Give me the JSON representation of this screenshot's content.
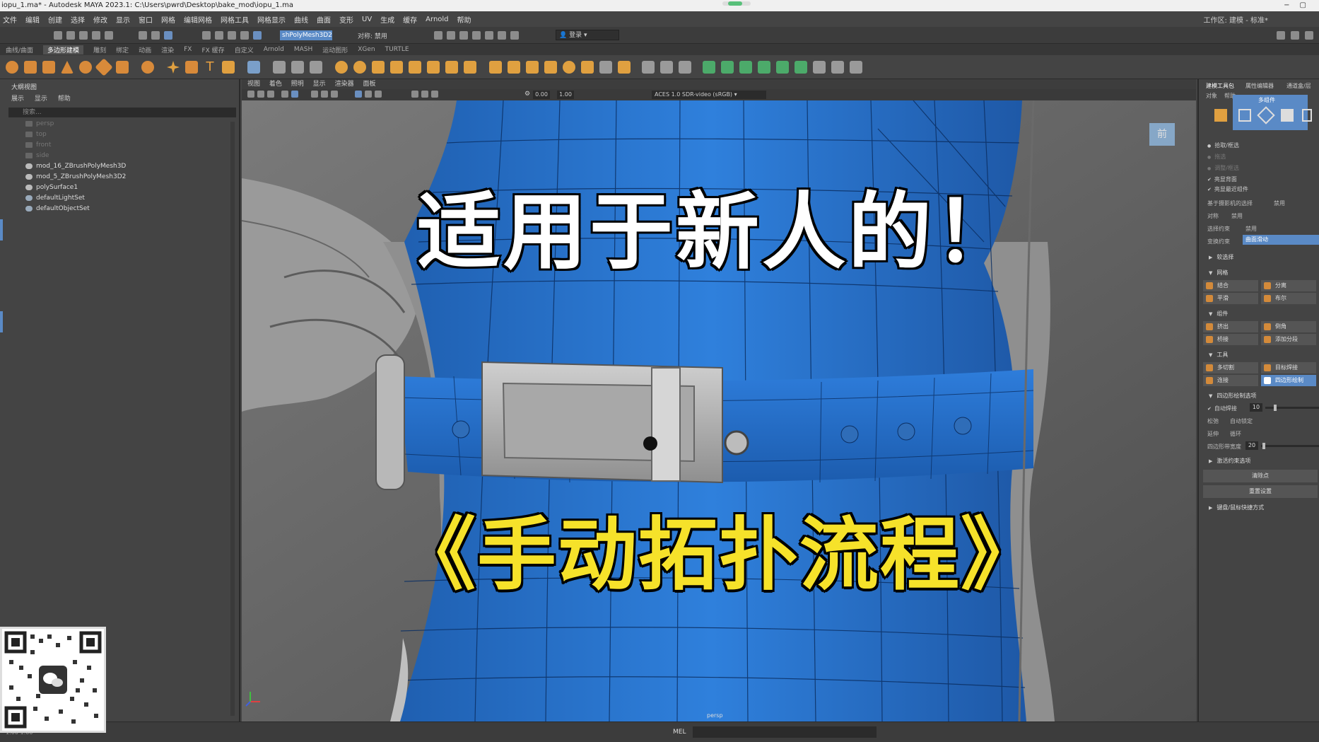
{
  "window": {
    "title": "iopu_1.ma* - Autodesk MAYA 2023.1: C:\\Users\\pwrd\\Desktop\\bake_mod\\iopu_1.ma",
    "controls": [
      "−",
      "▢"
    ]
  },
  "menubar": {
    "items": [
      "文件",
      "编辑",
      "创建",
      "选择",
      "修改",
      "显示",
      "窗口",
      "网格",
      "编辑网格",
      "网格工具",
      "网格显示",
      "曲线",
      "曲面",
      "变形",
      "UV",
      "生成",
      "缓存",
      "Arnold",
      "帮助"
    ],
    "workspace": "工作区: 建模 - 标准*"
  },
  "statusline": {
    "object_name": "shPolyMesh3D2",
    "symmetry": "对称: 禁用",
    "login": "登录"
  },
  "shelf": {
    "tabs": [
      "曲线/曲面",
      "多边形建模",
      "雕刻",
      "绑定",
      "动画",
      "渲染",
      "FX",
      "FX 缓存",
      "自定义",
      "Arnold",
      "MASH",
      "运动图形",
      "XGen",
      "TURTLE"
    ],
    "active_tab": "多边形建模"
  },
  "outliner": {
    "title": "大纲视图",
    "menu": [
      "展示",
      "显示",
      "帮助"
    ],
    "search_placeholder": "搜索...",
    "items": [
      {
        "label": "persp",
        "kind": "camera",
        "dim": true
      },
      {
        "label": "top",
        "kind": "camera",
        "dim": true
      },
      {
        "label": "front",
        "kind": "camera",
        "dim": true
      },
      {
        "label": "side",
        "kind": "camera",
        "dim": true
      },
      {
        "label": "mod_16_ZBrushPolyMesh3D",
        "kind": "mesh",
        "dim": false
      },
      {
        "label": "mod_5_ZBrushPolyMesh3D2",
        "kind": "mesh",
        "dim": false
      },
      {
        "label": "polySurface1",
        "kind": "mesh",
        "dim": false
      },
      {
        "label": "defaultLightSet",
        "kind": "set",
        "dim": false
      },
      {
        "label": "defaultObjectSet",
        "kind": "set",
        "dim": false
      }
    ]
  },
  "viewport": {
    "menu": [
      "视图",
      "着色",
      "照明",
      "显示",
      "渲染器",
      "面板"
    ],
    "exposure": "0.00",
    "gamma": "1.00",
    "color_space": "ACES 1.0 SDR-video (sRGB)",
    "camera_label": "persp",
    "viewcube_label": "前",
    "caption_line1": "适用于新人的！",
    "caption_line2": "《手动拓扑流程》",
    "mesh_color": "#2a77d6",
    "caption2_color": "#f6e22a"
  },
  "rightpanel": {
    "tabs": [
      "建模工具包",
      "属性编辑器",
      "通道盒/层"
    ],
    "menu": [
      "对象",
      "帮助"
    ],
    "mode_label": "多组件",
    "select_options": [
      {
        "label": "拾取/框选",
        "on": true
      },
      {
        "label": "拖选",
        "on": false
      },
      {
        "label": "调整/框选",
        "on": false
      }
    ],
    "checks": [
      "亮显背面",
      "亮显最近组件"
    ],
    "camera_based": "基于摄影机的选择",
    "camera_based_value": "禁用",
    "symmetry_label": "对称",
    "symmetry_value": "禁用",
    "select_constraint": "选择约束",
    "select_constraint_value": "禁用",
    "transform_constraint": "变换约束",
    "transform_constraint_value": "曲面滑动",
    "soft_select": "软选择",
    "sections": {
      "mesh": {
        "title": "网格",
        "buttons": [
          "结合",
          "分离",
          "平滑",
          "布尔"
        ]
      },
      "components": {
        "title": "组件",
        "buttons": [
          "挤出",
          "倒角",
          "桥接",
          "添加分段"
        ]
      },
      "tools": {
        "title": "工具",
        "buttons": [
          "多切割",
          "目标焊接",
          "连接",
          "四边形绘制"
        ]
      }
    },
    "quad_draw": {
      "title": "四边形绘制选项",
      "auto_weld": "自动焊接",
      "auto_weld_value": "10",
      "relax_label": "松弛",
      "relax_value": "自动锁定",
      "extend_label": "延伸",
      "extend_value": "循环",
      "quad_width_label": "四边形带宽度",
      "quad_width_value": "20",
      "constraints": "激活约束选项",
      "clear_button": "清除点",
      "reset_button": "重置设置",
      "hotkeys": "键盘/鼠标快捷方式"
    }
  },
  "cmdline": {
    "label": "MEL",
    "left_text": "1:00   1:00"
  }
}
